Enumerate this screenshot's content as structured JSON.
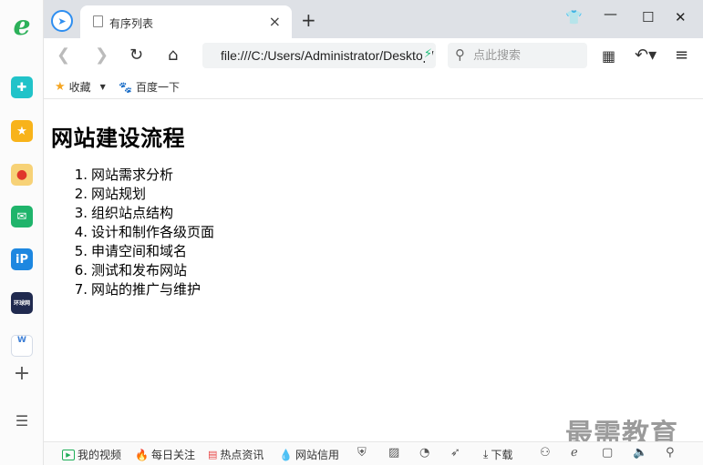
{
  "tab": {
    "title": "有序列表",
    "close": "×",
    "new_tab": "+"
  },
  "address_bar": {
    "url": "file:///C:/Users/Administrator/Desktop/"
  },
  "search": {
    "placeholder": "点此搜索"
  },
  "bookmarks": {
    "favorites": "收藏",
    "baidu": "百度一下"
  },
  "page": {
    "title": "网站建设流程",
    "steps": [
      {
        "num": "1.",
        "text": "网站需求分析"
      },
      {
        "num": "2.",
        "text": "网站规划"
      },
      {
        "num": "3.",
        "text": "组织站点结构"
      },
      {
        "num": "4.",
        "text": "设计和制作各级页面"
      },
      {
        "num": "5.",
        "text": "申请空间和域名"
      },
      {
        "num": "6.",
        "text": "测试和发布网站"
      },
      {
        "num": "7.",
        "text": "网站的推广与维护"
      }
    ]
  },
  "watermark": "最需教育",
  "statusbar": {
    "my_video": "我的视频",
    "daily_focus": "每日关注",
    "hot_news": "热点资讯",
    "site_credit": "网站信用",
    "download": "下载"
  },
  "sidebar": {
    "huanqiu_label": "环球网"
  },
  "colors": {
    "accent": "#2e8ef0",
    "ie_green": "#2db15a",
    "tab_bar": "#dee1e6"
  }
}
